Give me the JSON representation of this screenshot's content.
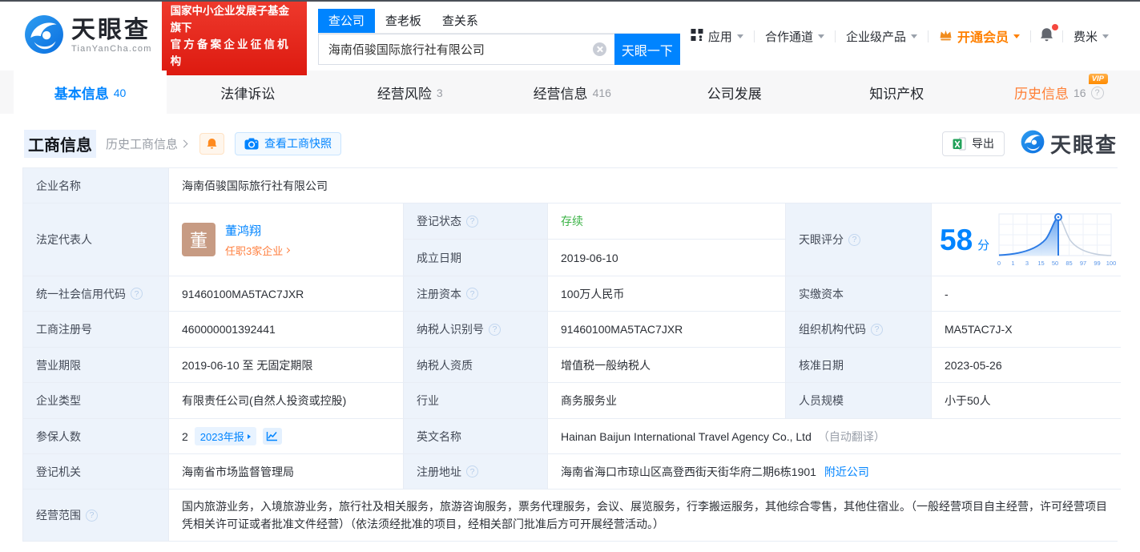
{
  "colors": {
    "accent": "#0084ff",
    "member_orange": "#ff8000",
    "status_green": "#3bb346",
    "badge_red": "#e0251b",
    "history_orange": "#ff7e33",
    "label_cell_bg": "#edf3fb"
  },
  "header": {
    "logo": {
      "name": "天眼查",
      "domain": "TianYanCha.com"
    },
    "gov_badge": {
      "line1": "国家中小企业发展子基金旗下",
      "line2": "官方备案企业征信机构"
    },
    "search": {
      "tabs": [
        {
          "label": "查公司"
        },
        {
          "label": "查老板"
        },
        {
          "label": "查关系"
        }
      ],
      "value": "海南佰骏国际旅行社有限公司",
      "button": "天眼一下"
    },
    "nav": {
      "apps": "应用",
      "partner": "合作通道",
      "enterprise": "企业级产品",
      "member": "开通会员",
      "user": "费米"
    }
  },
  "tabs": [
    {
      "label": "基本信息",
      "count": "40"
    },
    {
      "label": "法律诉讼",
      "count": ""
    },
    {
      "label": "经营风险",
      "count": "3"
    },
    {
      "label": "经营信息",
      "count": "416"
    },
    {
      "label": "公司发展",
      "count": ""
    },
    {
      "label": "知识产权",
      "count": ""
    },
    {
      "label": "历史信息",
      "count": "16",
      "vip": "VIP"
    }
  ],
  "section": {
    "title": "工商信息",
    "history_link": "历史工商信息",
    "snapshot": "查看工商快照",
    "export": "导出",
    "watermark": "天眼查"
  },
  "table": {
    "company_name": {
      "label": "企业名称",
      "value": "海南佰骏国际旅行社有限公司"
    },
    "legal_rep": {
      "label": "法定代表人",
      "avatar": "董",
      "name": "董鸿翔",
      "positions": "任职3家企业"
    },
    "reg_status": {
      "label": "登记状态",
      "value": "存续"
    },
    "establish_date": {
      "label": "成立日期",
      "value": "2019-06-10"
    },
    "score": {
      "label": "天眼评分",
      "value": "58",
      "unit": "分"
    },
    "credit_code": {
      "label": "统一社会信用代码",
      "value": "91460100MA5TAC7JXR"
    },
    "reg_capital": {
      "label": "注册资本",
      "value": "100万人民币"
    },
    "paid_capital": {
      "label": "实缴资本",
      "value": "-"
    },
    "reg_number": {
      "label": "工商注册号",
      "value": "460000001392441"
    },
    "taxpayer_id": {
      "label": "纳税人识别号",
      "value": "91460100MA5TAC7JXR"
    },
    "org_code": {
      "label": "组织机构代码",
      "value": "MA5TAC7J-X"
    },
    "business_term": {
      "label": "营业期限",
      "value": "2019-06-10 至 无固定期限"
    },
    "taxpayer_quality": {
      "label": "纳税人资质",
      "value": "增值税一般纳税人"
    },
    "approval_date": {
      "label": "核准日期",
      "value": "2023-05-26"
    },
    "company_type": {
      "label": "企业类型",
      "value": "有限责任公司(自然人投资或控股)"
    },
    "industry": {
      "label": "行业",
      "value": "商务服务业"
    },
    "staff_size": {
      "label": "人员规模",
      "value": "小于50人"
    },
    "insured": {
      "label": "参保人数",
      "value": "2",
      "report": "2023年报"
    },
    "english_name": {
      "label": "英文名称",
      "value": "Hainan Baijun International Travel Agency Co., Ltd",
      "note": "（自动翻译）"
    },
    "reg_authority": {
      "label": "登记机关",
      "value": "海南省市场监督管理局"
    },
    "reg_address": {
      "label": "注册地址",
      "value": "海南省海口市琼山区高登西街天街华府二期6栋1901",
      "nearby": "附近公司"
    },
    "business_scope": {
      "label": "经营范围",
      "value": "国内旅游业务，入境旅游业务，旅行社及相关服务，旅游咨询服务，票务代理服务，会议、展览服务，行李搬运服务，其他综合零售，其他住宿业。（一般经营项目自主经营，许可经营项目凭相关许可证或者批准文件经营）（依法须经批准的项目，经相关部门批准后方可开展经营活动。）"
    }
  },
  "chart_data": {
    "type": "area",
    "title": "天眼评分 score distribution curve",
    "x_ticks": [
      0,
      1,
      3,
      15,
      50,
      85,
      97,
      99,
      100
    ],
    "tick_labels": [
      "0",
      "1",
      "3",
      "15",
      "50",
      "85",
      "97",
      "99",
      "100"
    ],
    "score": 58,
    "marker_value": 58,
    "legend_position": "none",
    "grid": true
  }
}
